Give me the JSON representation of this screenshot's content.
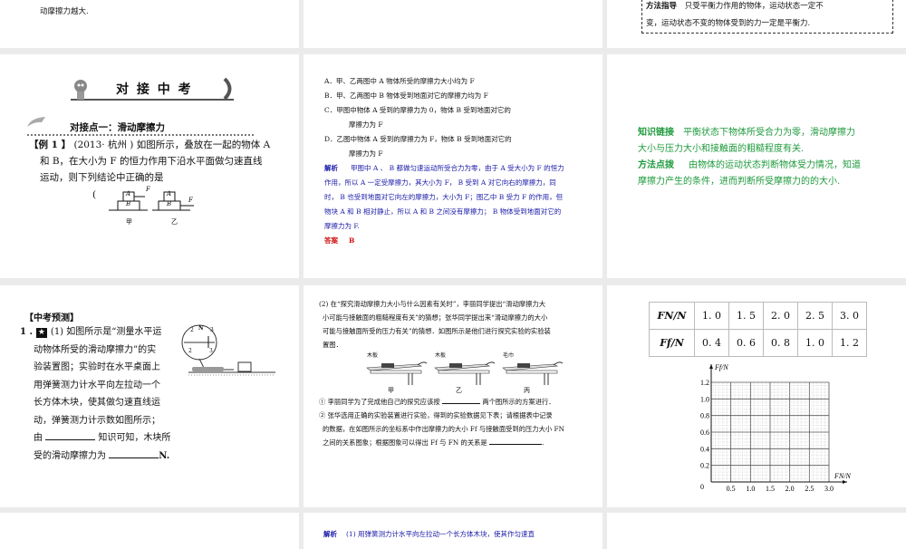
{
  "slides": {
    "s1": {
      "text": "动摩擦力越大."
    },
    "s3": {
      "label": "方法指导",
      "line1": "只受平衡力作用的物体，运动状态一定不",
      "line2": "变，运动状态不变的物体受到的力一定是平衡力."
    },
    "s4": {
      "banner": "对 接 中 考",
      "point": "对接点一：滑动摩擦力",
      "example_tag": "【例 1 】",
      "line1": "(2013· 杭州 ) 如图所示，叠放在一起的物体 A",
      "line2": "和 B，在大小为 F 的恒力作用下沿水平面做匀速直线",
      "line3": "运动，则下列结论中正确的是",
      "paren": "(",
      "fig": {
        "a": "A",
        "b": "B",
        "f": "F",
        "jia": "甲",
        "yi": "乙"
      }
    },
    "s5": {
      "options": [
        "A．甲、乙两图中 A 物体所受的摩擦力大小均为 F",
        "B．甲、乙两图中 B 物体受到地面对它的摩擦力均为 F",
        "C．甲图中物体 A 受到的摩擦力为 0，物体 B 受到地面对它的",
        "摩擦力为 F",
        "D．乙图中物体 A 受到的摩擦力为 F，物体 B 受到地面对它的",
        "摩擦力为 F"
      ],
      "analysis_label": "解析",
      "analysis": [
        "甲图中 A 、 B 都做匀速运动所受合力为零，由于 A 受大小为 F 的恒力",
        "作用，所以 A 一定受摩擦力，其大小为 F， B 受到 A 对它向右的摩擦力，同",
        "时， B 也受到地面对它向左的摩擦力，大小为 F；图乙中 B 受力 F 的作用，但",
        "物块 A 和 B 相对静止，所以 A 和 B 之间没有摩擦力； B 物体受到地面对它的",
        "摩擦力为 F."
      ],
      "answer_label": "答案",
      "answer": "B"
    },
    "s6": {
      "k_label": "知识链接",
      "k1": "平衡状态下物体所受合力为零，滑动摩擦力",
      "k2": "大小与压力大小和接触面的粗糙程度有关.",
      "m_label": "方法点拨",
      "m1": "由物体的运动状态判断物体受力情况，知道",
      "m2": "摩擦力产生的条件，进而判断所受摩擦力的的大小."
    },
    "s7": {
      "title": "【中考预测】",
      "num": "1 .",
      "lines": [
        "(1) 如图所示是“测量水平运",
        "动物体所受的滑动摩擦力”的实",
        "验装置图；实验时在水平桌面上",
        "用弹簧测力计水平向左拉动一个",
        "长方体木块，使其做匀速直线运",
        "动，弹簧测力计示数如图所示；"
      ],
      "l7a": "由",
      "l7b": "知识可知，木块所",
      "l8a": "受的滑动摩擦力为",
      "l8b": "N.",
      "gauge": {
        "unit": "N",
        "t2": "2",
        "t3": "3"
      }
    },
    "s8": {
      "lines": [
        "(2) 在“探究滑动摩擦力大小与什么因素有关时”，李丽同学提出“滑动摩擦力大",
        "小可能与接触面的粗糙程度有关”的猜想；张华同学提出来“滑动摩擦力的大小",
        "可能与接触面所受的压力有关”的猜想．如图所示是他们进行探究实验的实验装",
        "置图．"
      ],
      "figs": [
        {
          "surface": "木板",
          "cap": "甲"
        },
        {
          "surface": "木板",
          "cap": "乙"
        },
        {
          "surface": "毛巾",
          "cap": "丙"
        }
      ],
      "q1a": "① 李丽同学为了完成他自己的探究应该按",
      "q1b": "两个图所示的方案进行．",
      "q2": [
        "② 张华选用正确的实验装置进行实验，得到的实验数据见下表；请根据表中记录",
        "的数据，在如图所示的坐标系中作出摩擦力的大小 Ff 与接触面受到的压力大小 FN",
        "之间的关系图象；根据图象可以得出 Ff 与 FN 的关系是"
      ],
      "end": "."
    },
    "s9": {
      "table": {
        "rows": [
          {
            "head": "FN/N",
            "values": [
              "1. 0",
              "1. 5",
              "2. 0",
              "2. 5",
              "3. 0"
            ]
          },
          {
            "head": "Ff/N",
            "values": [
              "0. 4",
              "0. 6",
              "0. 8",
              "1. 0",
              "1. 2"
            ]
          }
        ]
      },
      "chart_data": {
        "type": "scatter",
        "xlabel": "FN/N",
        "ylabel": "Ff/N",
        "xticks": [
          "0.5",
          "1.0",
          "1.5",
          "2.0",
          "2.5",
          "3.0"
        ],
        "yticks": [
          "0.2",
          "0.4",
          "0.6",
          "0.8",
          "1.0",
          "1.2"
        ],
        "origin": "0",
        "xlim": [
          0,
          3.0
        ],
        "ylim": [
          0,
          1.2
        ],
        "grid": true,
        "x": [],
        "y": []
      }
    },
    "s11": {
      "label": "解析",
      "text": "(1) 用弹簧测力计水平向左拉动一个长方体木块，使其作匀速直"
    }
  }
}
